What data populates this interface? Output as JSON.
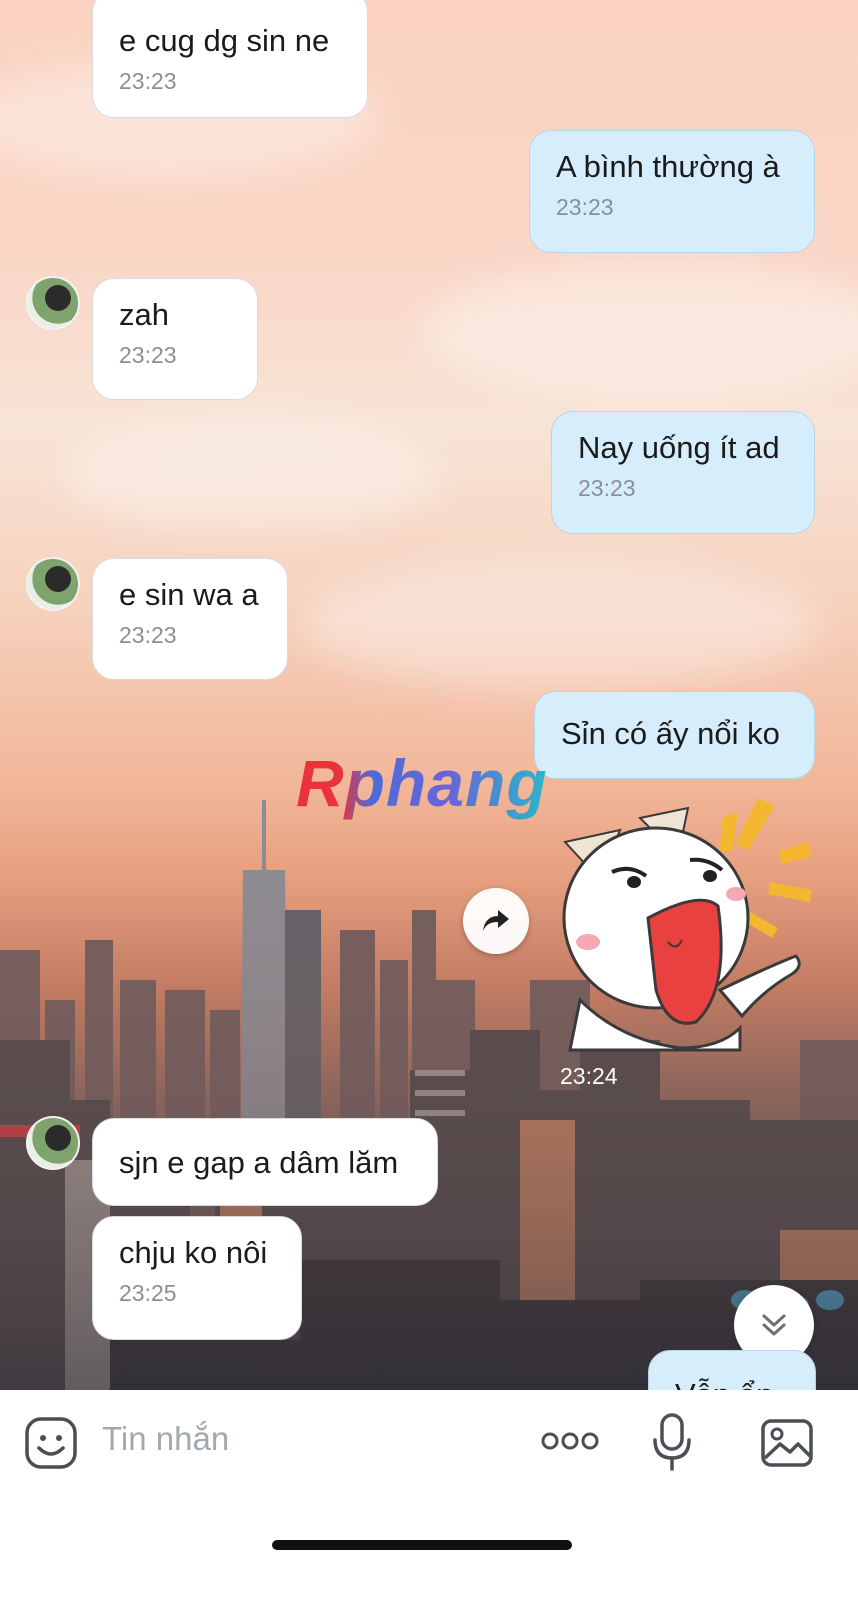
{
  "messages": [
    {
      "side": "in",
      "text": "e cug dg sin ne",
      "time": "23:23"
    },
    {
      "side": "out",
      "text": "A bình thường à",
      "time": "23:23"
    },
    {
      "side": "in",
      "text": "zah",
      "time": "23:23"
    },
    {
      "side": "out",
      "text": "Nay uống ít ad",
      "time": "23:23"
    },
    {
      "side": "in",
      "text": "e sin wa a",
      "time": "23:23"
    },
    {
      "side": "out",
      "text": "Sỉn có ấy nổi ko",
      "time": ""
    },
    {
      "side": "in",
      "text": "sjn e gap a dâm lăm",
      "time": ""
    },
    {
      "side": "in",
      "text": "chju ko nôi",
      "time": "23:25"
    }
  ],
  "partial_message": {
    "text": "Vẫn ổn"
  },
  "sticker": {
    "time": "23:24",
    "description_icon": "cat-sticker"
  },
  "watermark": {
    "text": "Rphang"
  },
  "input_bar": {
    "placeholder": "Tin nhắn",
    "icons": [
      "emoji-icon",
      "more-icon",
      "mic-icon",
      "image-icon"
    ]
  },
  "colors": {
    "incoming_bubble": "#ffffff",
    "outgoing_bubble": "#d6eefb",
    "time_text": "#8a8f96",
    "placeholder_text": "#a3a8ae"
  }
}
